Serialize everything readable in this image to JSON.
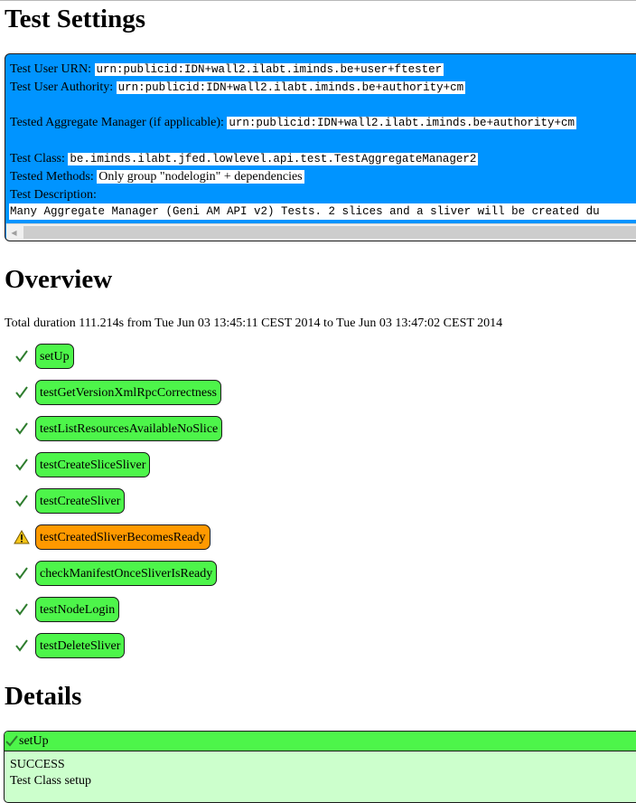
{
  "headings": {
    "settings": "Test Settings",
    "overview": "Overview",
    "details": "Details"
  },
  "settings": {
    "user_urn_label": "Test User URN:",
    "user_urn_value": "urn:publicid:IDN+wall2.ilabt.iminds.be+user+ftester",
    "user_authority_label": "Test User Authority:",
    "user_authority_value": "urn:publicid:IDN+wall2.ilabt.iminds.be+authority+cm",
    "am_label": "Tested Aggregate Manager (if applicable):",
    "am_value": "urn:publicid:IDN+wall2.ilabt.iminds.be+authority+cm",
    "test_class_label": "Test Class:",
    "test_class_value": "be.iminds.ilabt.jfed.lowlevel.api.test.TestAggregateManager2",
    "tested_methods_label": "Tested Methods:",
    "tested_methods_value": "Only group \"nodelogin\" + dependencies",
    "description_label": "Test Description:",
    "description_value": "Many Aggregate Manager (Geni AM API v2) Tests. 2 slices and a sliver will be created du"
  },
  "overview": {
    "duration": "Total duration 111.214s from Tue Jun 03 13:45:11 CEST 2014 to Tue Jun 03 13:47:02 CEST 2014",
    "tests": [
      {
        "name": "setUp",
        "status": "pass"
      },
      {
        "name": "testGetVersionXmlRpcCorrectness",
        "status": "pass"
      },
      {
        "name": "testListResourcesAvailableNoSlice",
        "status": "pass"
      },
      {
        "name": "testCreateSliceSliver",
        "status": "pass"
      },
      {
        "name": "testCreateSliver",
        "status": "pass"
      },
      {
        "name": "testCreatedSliverBecomesReady",
        "status": "warn"
      },
      {
        "name": "checkManifestOnceSliverIsReady",
        "status": "pass"
      },
      {
        "name": "testNodeLogin",
        "status": "pass"
      },
      {
        "name": "testDeleteSliver",
        "status": "pass"
      }
    ]
  },
  "details": {
    "first": {
      "name": "setUp",
      "result": "SUCCESS",
      "note": "Test Class setup"
    }
  },
  "colors": {
    "settings_bg": "#0094ff",
    "pass": "#4df54a",
    "warn": "#ff9900",
    "detail_body": "#ccffcc"
  }
}
